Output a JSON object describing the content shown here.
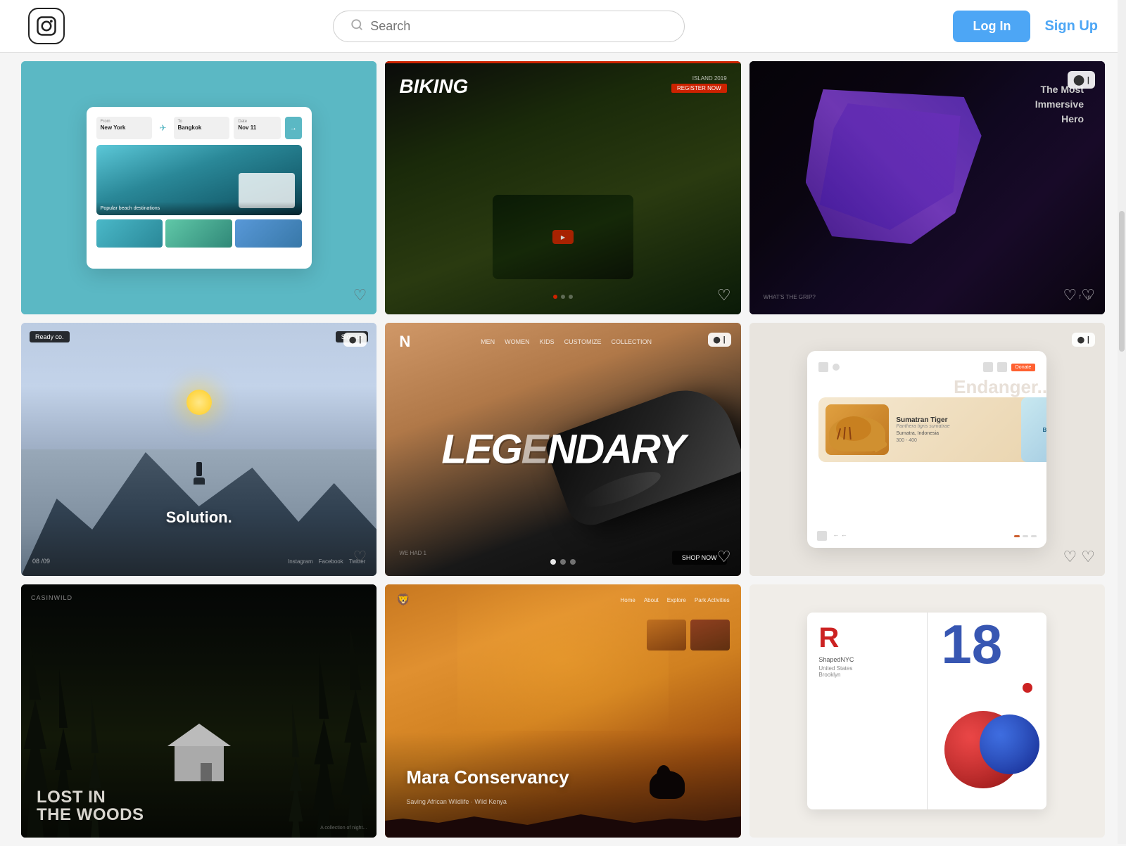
{
  "header": {
    "logo_alt": "Instagram logo",
    "search_placeholder": "Search",
    "login_label": "Log In",
    "signup_label": "Sign Up"
  },
  "grid": {
    "items": [
      {
        "id": 1,
        "type": "image",
        "alt": "Travel flight search UI mockup",
        "bg_color": "#5bb8c4",
        "has_heart": true,
        "heart_style": "dark"
      },
      {
        "id": 2,
        "type": "image",
        "alt": "Biking website dark UI",
        "bg_color": "#2d2d2d",
        "title": "Biking",
        "has_heart": true,
        "heart_style": "light"
      },
      {
        "id": 3,
        "type": "image",
        "alt": "Dark cinematic movie UI",
        "bg_color": "#1a1520",
        "has_heart": true,
        "heart_style": "light",
        "video_badge": true
      },
      {
        "id": 4,
        "type": "image",
        "alt": "Solution mountain website UI",
        "bg_color": "#b8c8d8",
        "title": "Solution.",
        "has_heart": true,
        "heart_style": "dark",
        "video_badge": true
      },
      {
        "id": 5,
        "type": "image",
        "alt": "Nike Legendary shoe campaign UI",
        "bg_color": "#c89070",
        "title": "LEGENDARY",
        "has_heart": true,
        "heart_style": "light",
        "video_badge": true
      },
      {
        "id": 6,
        "type": "image",
        "alt": "Endangered species Sumatran Tiger UI",
        "bg_color": "#e8e4de",
        "species": "Sumatran Tiger",
        "latin": "Panthera tigris sumatrae",
        "location": "Sumatra, Indonesia",
        "population": "300 - 400",
        "has_heart": true,
        "heart_style": "dark",
        "video_badge": true
      },
      {
        "id": 7,
        "type": "image",
        "alt": "Lost in the Woods dark forest UI",
        "bg_color": "#2a2820",
        "title": "LOST IN THE WOODS",
        "badge": "CASINWILD",
        "has_heart": false
      },
      {
        "id": 8,
        "type": "image",
        "alt": "Mara Conservancy orange UI",
        "bg_color": "#c87820",
        "title": "Mara Conservancy",
        "has_heart": false
      },
      {
        "id": 9,
        "type": "image",
        "alt": "R18 graphic design layout",
        "bg_color": "#f0ede8",
        "has_heart": false
      }
    ]
  }
}
